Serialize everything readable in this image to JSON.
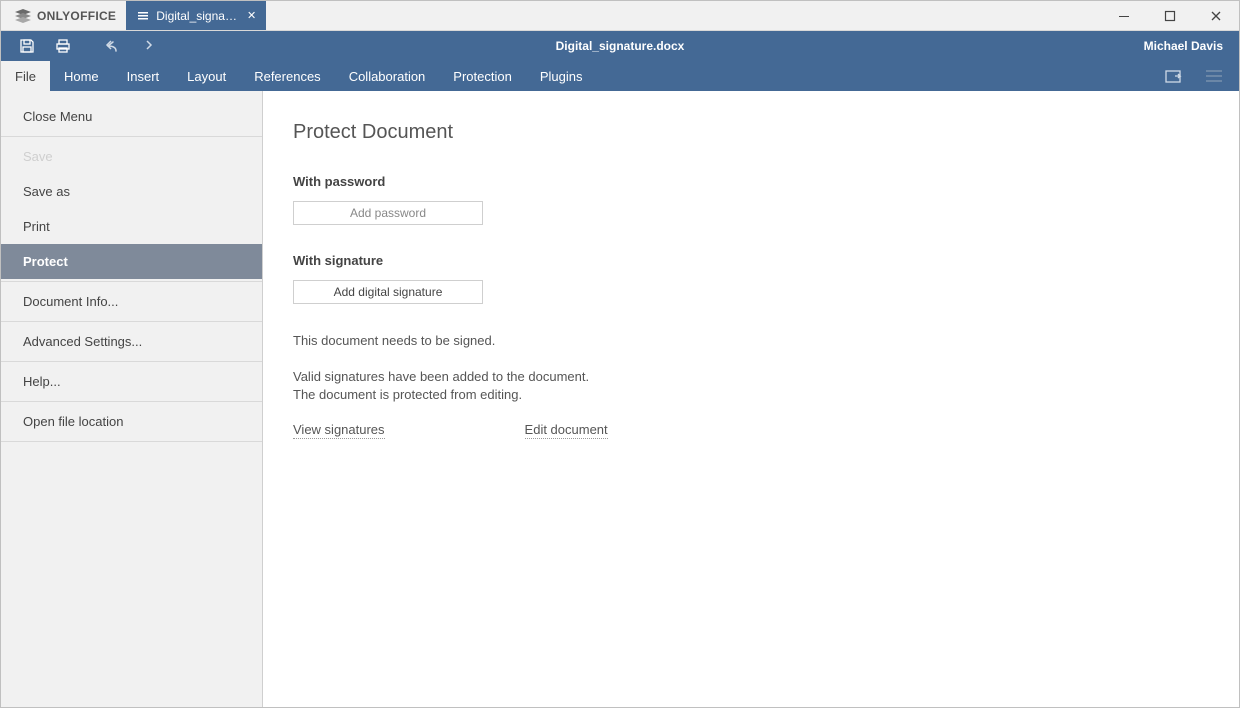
{
  "brand": "ONLYOFFICE",
  "tab_label": "Digital_signatur...",
  "doc_name": "Digital_signature.docx",
  "user_name": "Michael Davis",
  "ribbon": [
    "File",
    "Home",
    "Insert",
    "Layout",
    "References",
    "Collaboration",
    "Protection",
    "Plugins"
  ],
  "ribbon_active": 0,
  "sidebar": {
    "close_menu": "Close Menu",
    "save": "Save",
    "save_as": "Save as",
    "print": "Print",
    "protect": "Protect",
    "document_info": "Document Info...",
    "advanced_settings": "Advanced Settings...",
    "help": "Help...",
    "open_location": "Open file location"
  },
  "panel": {
    "title": "Protect Document",
    "with_password": "With password",
    "add_password": "Add password",
    "with_signature": "With signature",
    "add_digital_signature": "Add digital signature",
    "needs_sign": "This document needs to be signed.",
    "protected": "Valid signatures have been added to the document. The document is protected from editing.",
    "view_signatures": "View signatures",
    "edit_document": "Edit document"
  }
}
